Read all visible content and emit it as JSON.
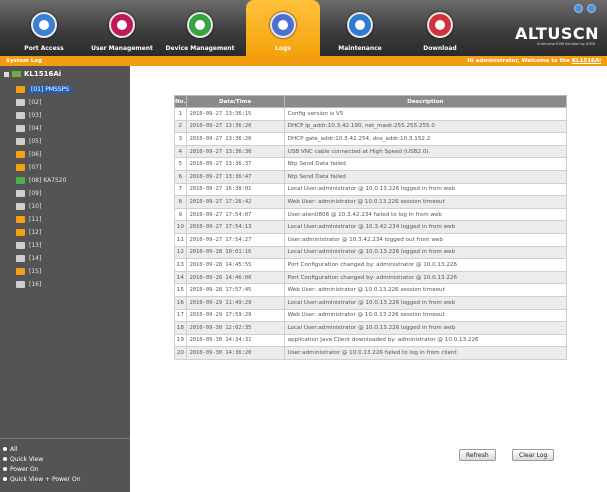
{
  "nav": {
    "items": [
      {
        "label": "Port Access",
        "color": "#3b7fd0"
      },
      {
        "label": "User Management",
        "color": "#c2185b"
      },
      {
        "label": "Device Management",
        "color": "#3aa341"
      },
      {
        "label": "Logs",
        "color": "#4f6fd0"
      },
      {
        "label": "Maintenance",
        "color": "#2f78d4"
      },
      {
        "label": "Download",
        "color": "#d0343a"
      }
    ],
    "active": "Logs",
    "brand": "ALTUSCN",
    "brand_sub": "Enterprise KVM Solution by ATEN"
  },
  "strip": {
    "section": "System Log",
    "welcome_prefix": "Hi administrator, Welcome to the ",
    "device": "KL1516Ai"
  },
  "sidebar": {
    "root": "KL1516Ai",
    "ports": [
      {
        "label": "[01] PMSSPS",
        "state": "on",
        "selected": true
      },
      {
        "label": "[02]",
        "state": "off"
      },
      {
        "label": "[03]",
        "state": "off"
      },
      {
        "label": "[04]",
        "state": "off"
      },
      {
        "label": "[05]",
        "state": "off"
      },
      {
        "label": "[06]",
        "state": "on"
      },
      {
        "label": "[07]",
        "state": "on"
      },
      {
        "label": "[08] KA7520",
        "state": "green"
      },
      {
        "label": "[09]",
        "state": "off"
      },
      {
        "label": "[10]",
        "state": "off"
      },
      {
        "label": "[11]",
        "state": "on"
      },
      {
        "label": "[12]",
        "state": "on"
      },
      {
        "label": "[13]",
        "state": "off"
      },
      {
        "label": "[14]",
        "state": "off"
      },
      {
        "label": "[15]",
        "state": "on"
      },
      {
        "label": "[16]",
        "state": "off"
      }
    ],
    "legend": [
      "All",
      "Quick View",
      "Power On",
      "Quick View + Power On"
    ]
  },
  "table": {
    "headers": [
      "No.",
      "Date/Time",
      "Description"
    ],
    "rows": [
      {
        "no": "1",
        "datetime": "2010-09-27  13:36:15",
        "desc": "Config version is V5"
      },
      {
        "no": "2",
        "datetime": "2010-09-27  13:36:20",
        "desc": "DHCP ip_addr:10.3.42.190, net_mask:255.255.255.0"
      },
      {
        "no": "3",
        "datetime": "2010-09-27  13:36:20",
        "desc": "DHCP gate_addr:10.3.42.254, dns_addr:10.3.152.2"
      },
      {
        "no": "4",
        "datetime": "2010-09-27  13:36:30",
        "desc": "USB VNC cable connected at High Speed (USB2.0)."
      },
      {
        "no": "5",
        "datetime": "2010-09-27  13:36:37",
        "desc": "Ntp Send Data failed"
      },
      {
        "no": "6",
        "datetime": "2010-09-27  13:36:47",
        "desc": "Ntp Send Data failed"
      },
      {
        "no": "7",
        "datetime": "2010-09-27  16:38:01",
        "desc": "Local User:administrator @ 10.0.13.226 logged in from web"
      },
      {
        "no": "8",
        "datetime": "2010-09-27  17:26:42",
        "desc": "Web User: administrator @ 10.0.13.226 session timeout"
      },
      {
        "no": "9",
        "datetime": "2010-09-27  17:54:07",
        "desc": "User:aten0808 @ 10.3.42.234 failed to log in from web"
      },
      {
        "no": "10",
        "datetime": "2010-09-27  17:54:13",
        "desc": "Local User:administrator @ 10.3.42.234 logged in from web"
      },
      {
        "no": "11",
        "datetime": "2010-09-27  17:54:27",
        "desc": "User:administrator @ 10.3.42.234 logged out from web"
      },
      {
        "no": "12",
        "datetime": "2010-09-28  10:01:16",
        "desc": "Local User:administrator @ 10.0.13.226 logged in from web"
      },
      {
        "no": "13",
        "datetime": "2010-09-28  14:45:55",
        "desc": "Port Configuration changed by: administrator @ 10.0.13.226"
      },
      {
        "no": "14",
        "datetime": "2010-09-28  14:46:00",
        "desc": "Port Configuration changed by: administrator @ 10.0.13.226"
      },
      {
        "no": "15",
        "datetime": "2010-09-28  17:57:45",
        "desc": "Web User: administrator @ 10.0.13.226 session timeout"
      },
      {
        "no": "16",
        "datetime": "2010-09-29  11:49:29",
        "desc": "Local User:administrator @ 10.0.13.226 logged in from web"
      },
      {
        "no": "17",
        "datetime": "2010-09-29  17:59:29",
        "desc": "Web User: administrator @ 10.0.13.226 session timeout"
      },
      {
        "no": "18",
        "datetime": "2010-09-30  12:02:35",
        "desc": "Local User:administrator @ 10.0.13.226 logged in from web"
      },
      {
        "no": "19",
        "datetime": "2010-09-30  14:34:31",
        "desc": "application Java Client downloaded by: administrator @ 10.0.13.226"
      },
      {
        "no": "20",
        "datetime": "2010-09-30  14:36:20",
        "desc": "User:administrator @ 10.0.13.226 failed to log in from client"
      }
    ]
  },
  "buttons": {
    "refresh": "Refresh",
    "clear": "Clear Log"
  },
  "colors": {
    "accent": "#f39c12",
    "sidebar": "#545454",
    "topbar": "#3e3e3e"
  }
}
